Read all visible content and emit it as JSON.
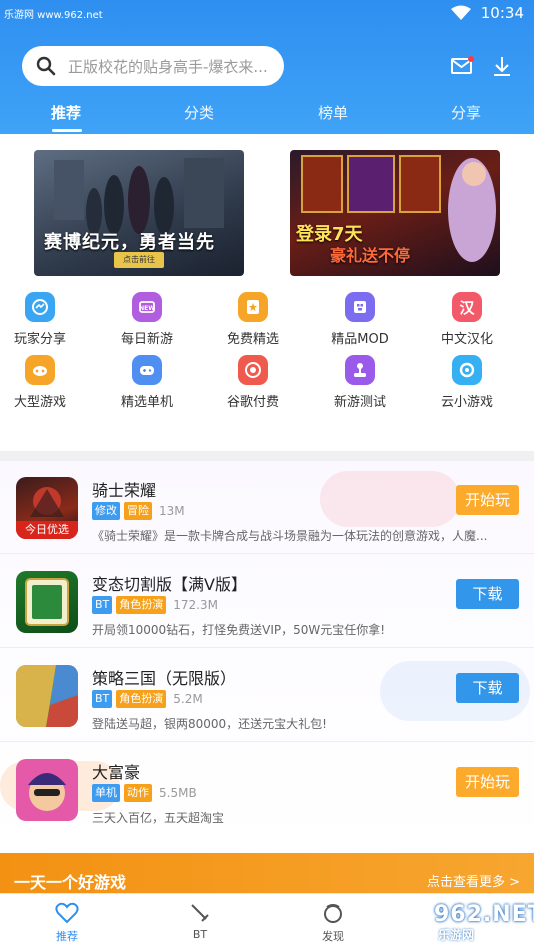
{
  "watermark_top": "乐游网 www.962.net",
  "status": {
    "time": "10:34"
  },
  "search": {
    "placeholder": "正版校花的贴身高手-爆衣来..."
  },
  "tabs": [
    "推荐",
    "分类",
    "榜单",
    "分享"
  ],
  "banners": [
    {
      "text": "赛博纪元，勇者当先",
      "button": "点击前往"
    },
    {
      "text_1": "登录7天",
      "text_2": "豪礼送不停"
    }
  ],
  "categories": [
    {
      "label": "玩家分享",
      "icon": "messenger-icon",
      "color": "#3aa6f3"
    },
    {
      "label": "每日新游",
      "icon": "new-badge-icon",
      "color": "#b05de0"
    },
    {
      "label": "免费精选",
      "icon": "star-card-icon",
      "color": "#f7a529"
    },
    {
      "label": "精品MOD",
      "icon": "cube-icon",
      "color": "#7b6cf0"
    },
    {
      "label": "中文汉化",
      "icon": "han-icon",
      "color": "#f25a6a",
      "glyph": "汉"
    },
    {
      "label": "大型游戏",
      "icon": "game-bubble-icon",
      "color": "#f7a529"
    },
    {
      "label": "精选单机",
      "icon": "gamepad-icon",
      "color": "#4f8ff2"
    },
    {
      "label": "谷歌付费",
      "icon": "chrome-icon",
      "color": "#f0594e"
    },
    {
      "label": "新游测试",
      "icon": "joystick-icon",
      "color": "#9a5bea"
    },
    {
      "label": "云小游戏",
      "icon": "ring-icon",
      "color": "#35b0f2"
    }
  ],
  "games": [
    {
      "title": "骑士荣耀",
      "tags": [
        {
          "text": "修改",
          "color": "blue"
        },
        {
          "text": "冒险",
          "color": "orange"
        }
      ],
      "size": "13M",
      "desc": "《骑士荣耀》是一款卡牌合成与战斗场景融为一体玩法的创意游戏，人魔...",
      "action": "开始玩",
      "badge": "今日优选"
    },
    {
      "title": "变态切割版【满V版】",
      "tags": [
        {
          "text": "BT",
          "color": "blue"
        },
        {
          "text": "角色扮演",
          "color": "orange"
        }
      ],
      "size": "172.3M",
      "desc": "开局领10000钻石，打怪免费送VIP，50W元宝任你拿!",
      "action": "下载"
    },
    {
      "title": "策略三国（无限版）",
      "tags": [
        {
          "text": "BT",
          "color": "blue"
        },
        {
          "text": "角色扮演",
          "color": "orange"
        }
      ],
      "size": "5.2M",
      "desc": "登陆送马超，银两80000，还送元宝大礼包!",
      "action": "下载"
    },
    {
      "title": "大富豪",
      "tags": [
        {
          "text": "单机",
          "color": "blue"
        },
        {
          "text": "动作",
          "color": "orange"
        }
      ],
      "size": "5.5MB",
      "desc": "三天入百亿，五天超淘宝",
      "action": "开始玩"
    }
  ],
  "promo": {
    "title": "一天一个好游戏",
    "more": "点击查看更多 >"
  },
  "bottom_nav": [
    {
      "label": "推荐",
      "icon": "heart-icon"
    },
    {
      "label": "BT",
      "icon": "sword-icon"
    },
    {
      "label": "发现",
      "icon": "planet-icon"
    }
  ],
  "watermark_bottom": {
    "number": "962.NET",
    "site": "乐游网"
  }
}
